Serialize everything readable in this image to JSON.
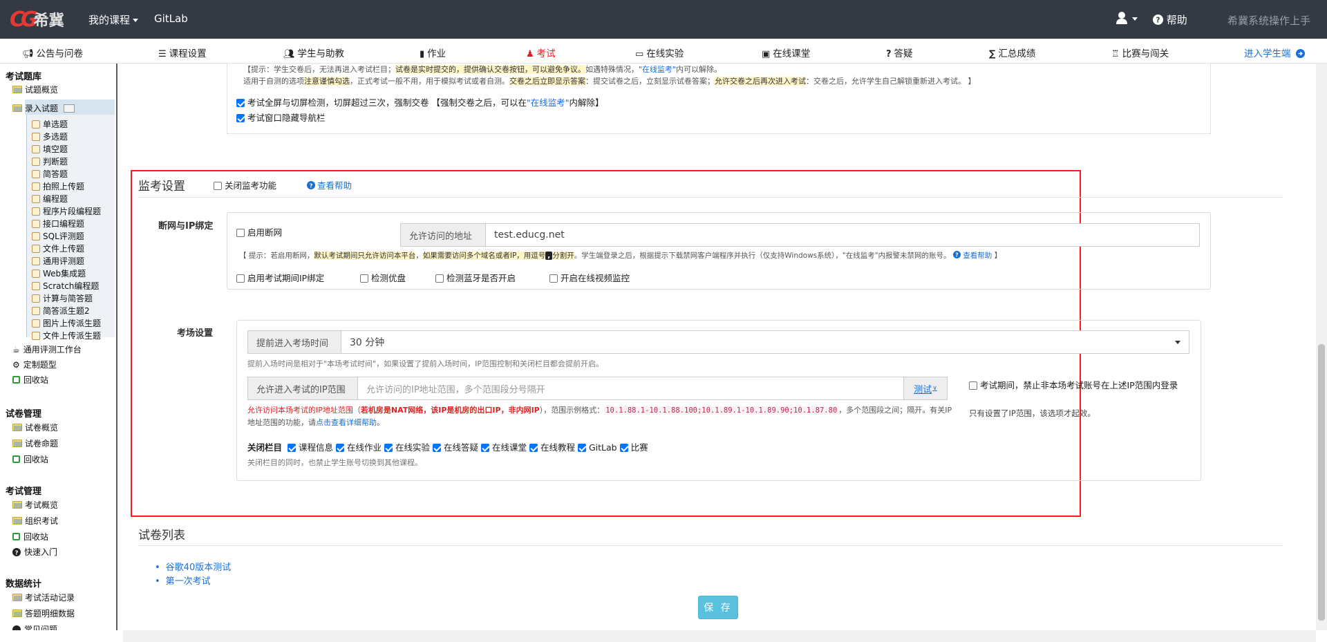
{
  "topbar": {
    "logo_mark": "CG",
    "logo_text": "希冀",
    "my_courses": "我的课程",
    "gitlab": "GitLab",
    "help": "帮助",
    "system_name": "希冀系统操作上手"
  },
  "nav": {
    "items": [
      "公告与问卷",
      "课程设置",
      "学生与助教",
      "作业",
      "考试",
      "在线实验",
      "在线课堂",
      "答疑",
      "汇总成绩",
      "比赛与闯关"
    ],
    "enter_student": "进入学生端"
  },
  "sidebar": {
    "sec1": "考试题库",
    "bank_overview": "试题概览",
    "enter_questions": "录入试题",
    "question_types": [
      "单选题",
      "多选题",
      "填空题",
      "判断题",
      "简答题",
      "拍照上传题",
      "编程题",
      "程序片段编程题",
      "接口编程题",
      "SQL评测题",
      "文件上传题",
      "通用评测题",
      "Web集成题",
      "Scratch编程题",
      "计算与简答题",
      "简答派生题2",
      "图片上传派生题",
      "文件上传派生题"
    ],
    "general_eval": "通用评测工作台",
    "custom_type": "定制题型",
    "recycle1": "回收站",
    "sec2": "试卷管理",
    "paper_overview": "试卷概览",
    "paper_make": "试卷命题",
    "recycle2": "回收站",
    "sec3": "考试管理",
    "exam_overview": "考试概览",
    "organize_exam": "组织考试",
    "recycle3": "回收站",
    "quick_start": "快速入门",
    "sec4": "数据统计",
    "exam_activity": "考试活动记录",
    "answer_detail": "答题明细数据",
    "faq": "常见问题"
  },
  "upper": {
    "tip1_a": "【提示：学生交卷后，无法再进入考试栏目；",
    "tip1_b": "试卷是实时提交的，提供确认交卷按钮，可以避免争议。",
    "tip1_c": "如遇特殊情况，",
    "tip1_d": "\"在线监考\"",
    "tip1_e": "内可以解除。",
    "tip2_a": "适用于自测的选项",
    "tip2_b": "注意谨慎勾选",
    "tip2_c": "，正式考试一般不用，用于模拟考试或者自测。",
    "tip2_d": "交卷之后立即显示答案",
    "tip2_e": "：提交试卷之后，立刻显示试卷答案；",
    "tip2_f": "允许交卷之后再次进入考试",
    "tip2_g": "：交卷之后，允许学生自己解锁重新进入考试。 】",
    "fullscreen_a": "考试全屏与切屏检测，切屏超过三次，强制交卷 【强制交卷之后，可以在",
    "fullscreen_b": "\"在线监考\"",
    "fullscreen_c": "内解除】",
    "hide_nav": "考试窗口隐藏导航栏"
  },
  "proctor": {
    "title": "监考设置",
    "close_proctor": "关闭监考功能",
    "view_help": "查看帮助",
    "net_label": "断网与IP绑定",
    "enable_disconnect": "启用断网",
    "allowed_addr_label": "允许访问的地址",
    "allowed_addr_value": "test.educg.net",
    "hint_a": "【 提示：若启用断网，",
    "hint_b": "默认考试期间只允许访问本平台",
    "hint_c": "，",
    "hint_d": "如果需要访问多个域名或者IP，用逗号",
    "hint_comma": ",",
    "hint_e": "分割开",
    "hint_f": "。学生端登录之后，根据提示下载禁网客户端程序并执行（仅支持Windows系统），\"在线监考\"内报警未禁网的账号。",
    "hint_help": "查看帮助",
    "hint_end": "】",
    "opt_ip_bind": "启用考试期间IP绑定",
    "opt_usb": "检测优盘",
    "opt_bt": "检测蓝牙是否开启",
    "opt_video": "开启在线视频监控",
    "venue_label": "考场设置",
    "early_label": "提前进入考场时间",
    "early_value": "30 分钟",
    "early_hint": "提前入场时间是相对于\"本场考试时间\"，如果设置了提前入场时间，IP范围控制和关闭栏目都会提前开启。",
    "ip_label": "允许进入考试的IP范围",
    "ip_placeholder": "允许访问的IP地址范围，多个范围段分号隔开",
    "test_btn": "测试",
    "ip_hint_a": "允许访问本场考试的IP地址范围（",
    "ip_hint_b": "若机房是NAT网络，该IP是机房的出口IP，非内网IP",
    "ip_hint_c": "），范围示例格式：",
    "ip_example": "10.1.88.1-10.1.88.100;10.1.89.1-10.1.89.90;10.1.87.80",
    "ip_hint_d": "，多个范围段之",
    "ip_hint_e": "间；隔开。有关IP地址范围的功能，请",
    "ip_hint_link": "点击查看详细帮助",
    "ip_hint_f": "。",
    "forbid_a": "考试期间，禁止非本场考试账号在上述IP范围内",
    "forbid_b": "登录",
    "forbid_hint": "只有设置了IP范围，该选项才起效。",
    "close_cols_label": "关闭栏目",
    "close_cols": [
      "课程信息",
      "在线作业",
      "在线实验",
      "在线答疑",
      "在线课堂",
      "在线教程",
      "GitLab",
      "比赛"
    ],
    "close_hint": "关闭栏目的同时，也禁止学生账号切换到其他课程。"
  },
  "papers": {
    "title": "试卷列表",
    "items": [
      "谷歌40版本测试",
      "第一次考试"
    ]
  },
  "save": "保 存",
  "colors": {
    "topbar": "#333a43",
    "accent_red": "#e02020",
    "link_blue": "#1a6fd1",
    "save_btn": "#5bc0de",
    "highlight_box": "#ff1a1a"
  }
}
